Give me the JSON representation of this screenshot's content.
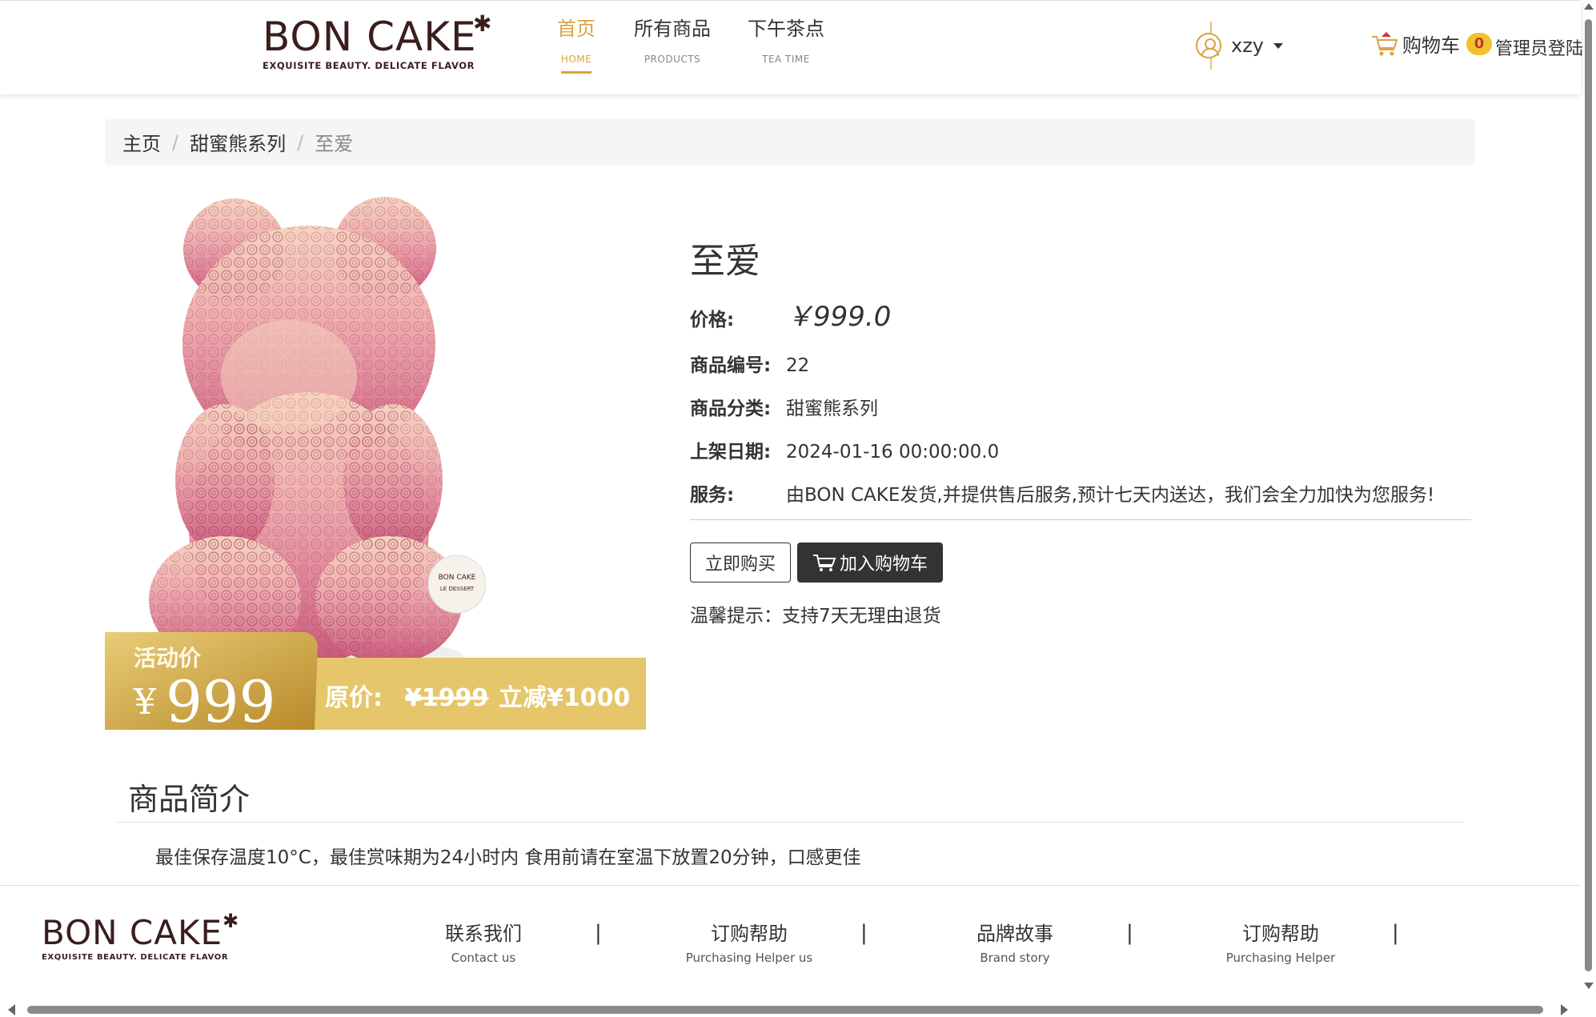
{
  "header": {
    "logo": {
      "wordmark": "BON CAKE",
      "tagline": "EXQUISITE BEAUTY. DELICATE FLAVOR"
    },
    "nav": [
      {
        "cn": "首页",
        "en": "HOME"
      },
      {
        "cn": "所有商品",
        "en": "PRODUCTS"
      },
      {
        "cn": "下午茶点",
        "en": "TEA TIME"
      }
    ],
    "active_nav_index": 0,
    "user": {
      "name": "xzy",
      "icon": "user-circle-icon"
    },
    "cart": {
      "label": "购物车",
      "count": "0",
      "icon": "shopping-cart-icon"
    },
    "admin_login": "管理员登陆"
  },
  "breadcrumb": {
    "home": "主页",
    "category": "甜蜜熊系列",
    "current": "至爱"
  },
  "product": {
    "title": "至爱",
    "price_label": "价格:",
    "price": "￥999.0",
    "id_label": "商品编号:",
    "id": "22",
    "category_label": "商品分类:",
    "category": "甜蜜熊系列",
    "date_label": "上架日期:",
    "date": "2024-01-16 00:00:00.0",
    "service_label": "服务:",
    "service": "由BON CAKE发货,并提供售后服务,预计七天内送达，我们会全力加快为您服务!",
    "buy_now": "立即购买",
    "add_to_cart": "加入购物车",
    "tip": "温馨提示：支持7天无理由退货",
    "image_banner": {
      "promo_label": "活动价",
      "promo_currency": "¥",
      "promo_price": "999",
      "original_label": "原价:",
      "original_price": "¥1999",
      "discount": "立减¥1000"
    },
    "badge": {
      "line1": "BON CAKE",
      "line2": "LE DESSERT"
    }
  },
  "description": {
    "heading": "商品简介",
    "text": "最佳保存温度10°C，最佳赏味期为24小时内 食用前请在室温下放置20分钟，口感更佳"
  },
  "footer": {
    "logo": {
      "wordmark": "BON CAKE",
      "tagline": "EXQUISITE BEAUTY. DELICATE FLAVOR"
    },
    "links": [
      {
        "cn": "联系我们",
        "en": "Contact us"
      },
      {
        "cn": "订购帮助",
        "en": "Purchasing Helper us"
      },
      {
        "cn": "品牌故事",
        "en": "Brand story"
      },
      {
        "cn": "订购帮助",
        "en": "Purchasing Helper"
      }
    ],
    "separator": "|"
  },
  "colors": {
    "accent": "#d9a441",
    "brand_dark": "#3a1e1c",
    "cart_badge": "#f2c12e",
    "banner_gold": "#e6c66a"
  }
}
